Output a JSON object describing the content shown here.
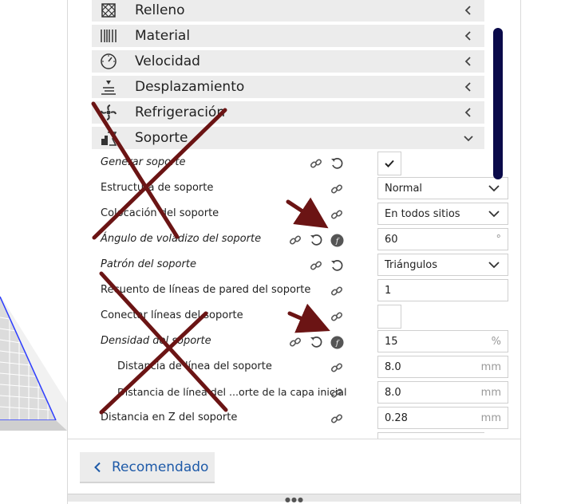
{
  "categories": [
    {
      "label": "Relleno",
      "expanded": false
    },
    {
      "label": "Material",
      "expanded": false
    },
    {
      "label": "Velocidad",
      "expanded": false
    },
    {
      "label": "Desplazamiento",
      "expanded": false
    },
    {
      "label": "Refrigeración",
      "expanded": false
    },
    {
      "label": "Soporte",
      "expanded": true
    }
  ],
  "settings": [
    {
      "label": "Generar soporte",
      "italic": true,
      "type": "checkbox",
      "checked": true
    },
    {
      "label": "Estructura de soporte",
      "italic": false,
      "type": "dropdown",
      "value": "Normal"
    },
    {
      "label": "Colocación del soporte",
      "italic": false,
      "type": "dropdown",
      "value": "En todos sitios"
    },
    {
      "label": "Ángulo de voladizo del soporte",
      "italic": true,
      "type": "number",
      "value": "60",
      "unit": "°"
    },
    {
      "label": "Patrón del soporte",
      "italic": true,
      "type": "dropdown",
      "value": "Triángulos"
    },
    {
      "label": "Recuento de líneas de pared del soporte",
      "italic": false,
      "type": "number",
      "value": "1",
      "unit": ""
    },
    {
      "label": "Conectar líneas del soporte",
      "italic": false,
      "type": "checkbox",
      "checked": false
    },
    {
      "label": "Densidad del soporte",
      "italic": true,
      "type": "number",
      "value": "15",
      "unit": "%"
    },
    {
      "label": "Distancia de línea del soporte",
      "italic": false,
      "type": "number",
      "value": "8.0",
      "unit": "mm"
    },
    {
      "label": "Distancia de línea del ...orte de la capa inicial",
      "italic": false,
      "type": "number",
      "value": "8.0",
      "unit": "mm"
    },
    {
      "label": "Distancia en Z del soporte",
      "italic": false,
      "type": "number",
      "value": "0.28",
      "unit": "mm"
    }
  ],
  "footer": {
    "recommended_label": "Recomendado"
  },
  "colors": {
    "accent": "#1e5aa8",
    "scrollbar": "#0a0a4a",
    "annotation": "#6b1414"
  }
}
